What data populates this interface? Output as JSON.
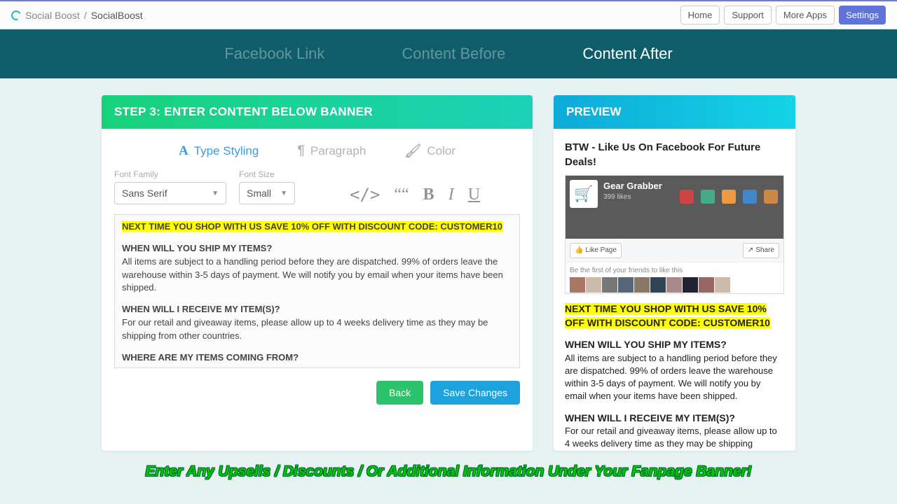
{
  "breadcrumb": {
    "crumb1": "Social Boost",
    "sep": "/",
    "crumb2": "SocialBoost"
  },
  "top": {
    "home": "Home",
    "support": "Support",
    "more": "More Apps",
    "settings": "Settings"
  },
  "tabs": {
    "fb": "Facebook Link",
    "before": "Content Before",
    "after": "Content After"
  },
  "main": {
    "header": "STEP 3: ENTER CONTENT BELOW BANNER",
    "styletabs": {
      "type": "Type Styling",
      "para": "Paragraph",
      "color": "Color"
    },
    "labels": {
      "family": "Font Family",
      "size": "Font Size"
    },
    "values": {
      "family": "Sans Serif",
      "size": "Small"
    },
    "fmt": {
      "code": "</>",
      "quote": "““",
      "bold": "B",
      "italic": "I",
      "under": "U"
    },
    "editor": {
      "highlight": "NEXT TIME YOU SHOP WITH US SAVE 10% OFF WITH DISCOUNT CODE: CUSTOMER10",
      "q1": "WHEN WILL YOU SHIP MY ITEMS?",
      "a1": "All items are subject to a handling period before they are dispatched. 99% of orders leave the warehouse within 3-5 days of payment. We will notify you by email when your items have been shipped.",
      "q2": "WHEN WILL I RECEIVE MY ITEM(S)?",
      "a2": "For our retail and giveaway items, please allow up to 4 weeks delivery time as they may be shipping from other countries.",
      "q3": "WHERE ARE MY ITEMS COMING FROM?"
    },
    "back": "Back",
    "save": "Save Changes"
  },
  "preview": {
    "header": "PREVIEW",
    "title": "BTW - Like Us On Facebook For Future Deals!",
    "fb": {
      "name": "Gear Grabber",
      "likes": "399 likes",
      "like": "Like Page",
      "share": "Share",
      "friends": "Be the first of your friends to like this"
    },
    "highlight": "NEXT TIME YOU SHOP WITH US SAVE 10% OFF WITH DISCOUNT CODE: CUSTOMER10",
    "q1": "WHEN WILL YOU SHIP MY ITEMS?",
    "a1": "All items are subject to a handling period before they are dispatched. 99% of orders leave the warehouse within 3-5 days of payment. We will notify you by email when your items have been shipped.",
    "q2": "WHEN WILL I RECEIVE MY ITEM(S)?",
    "a2": "For our retail and giveaway items, please allow up to 4 weeks delivery time as they may be shipping"
  },
  "caption": "Enter Any Upsells / Discounts / Or Additional Information Under Your Fanpage Banner!"
}
